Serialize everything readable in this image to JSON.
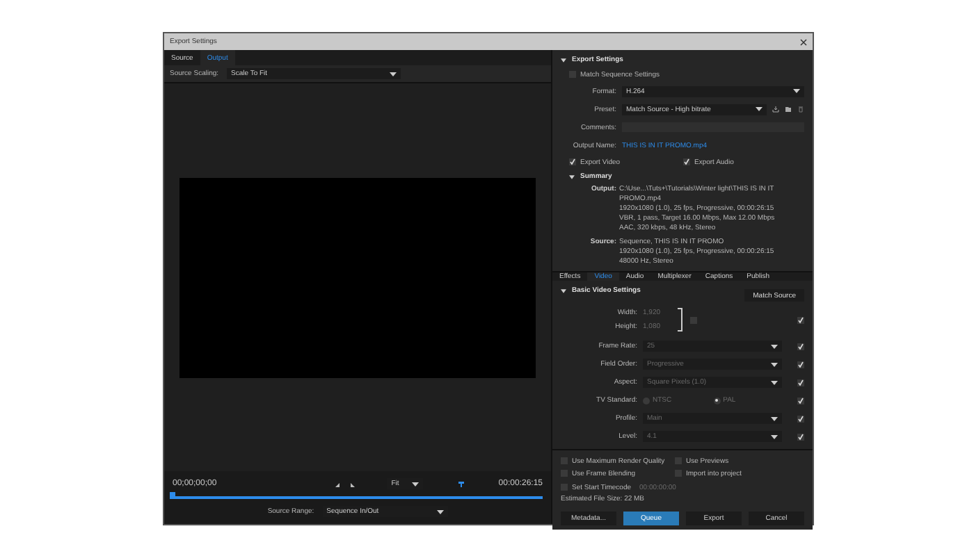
{
  "window": {
    "title": "Export Settings"
  },
  "source_tabs": [
    {
      "label": "Source",
      "selected": false
    },
    {
      "label": "Output",
      "selected": true
    }
  ],
  "source_scaling": {
    "label": "Source Scaling:",
    "value": "Scale To Fit"
  },
  "timeline": {
    "current_time": "00;00;00;00",
    "zoom": "Fit",
    "duration": "00:00:26:15",
    "level": 0,
    "source_range_label": "Source Range:",
    "source_range": "Sequence In/Out"
  },
  "export_settings": {
    "heading": "Export Settings",
    "match_sequence": {
      "label": "Match Sequence Settings",
      "checked": false
    },
    "format_label": "Format:",
    "format": "H.264",
    "preset_label": "Preset:",
    "preset": "Match Source - High bitrate",
    "comments_label": "Comments:",
    "output_name_label": "Output Name:",
    "output_name": "THIS IS IN IT PROMO.mp4",
    "exports": [
      {
        "label": "Export Video",
        "checked": true
      },
      {
        "label": "Export Audio",
        "checked": true
      }
    ],
    "summary": {
      "heading": "Summary",
      "output_label": "Output:",
      "output_lines": [
        "C:\\Use...\\Tuts+\\Tutorials\\Winter light\\THIS IS IN IT PROMO.mp4",
        "1920x1080 (1.0), 25 fps, Progressive, 00:00:26:15",
        "VBR, 1 pass, Target 16.00 Mbps, Max 12.00 Mbps",
        "AAC, 320 kbps, 48 kHz, Stereo"
      ],
      "source_label": "Source:",
      "source_lines": [
        "Sequence, THIS IS IN IT PROMO",
        "1920x1080 (1.0), 25 fps, Progressive, 00:00:26:15",
        "48000 Hz, Stereo"
      ]
    }
  },
  "settings_tabs": [
    {
      "label": "Effects",
      "selected": false
    },
    {
      "label": "Video",
      "selected": true
    },
    {
      "label": "Audio",
      "selected": false
    },
    {
      "label": "Multiplexer",
      "selected": false
    },
    {
      "label": "Captions",
      "selected": false
    },
    {
      "label": "Publish",
      "selected": false
    }
  ],
  "video_settings": {
    "heading": "Basic Video Settings",
    "match_source": "Match Source",
    "width": {
      "label": "Width:",
      "value": "1,920"
    },
    "height": {
      "label": "Height:",
      "value": "1,080"
    },
    "dimensions_checked": true,
    "rows": [
      {
        "kind": "dropdown",
        "label": "Frame Rate:",
        "value": "25",
        "checked": true
      },
      {
        "kind": "dropdown",
        "label": "Field Order:",
        "value": "Progressive",
        "checked": true
      },
      {
        "kind": "dropdown",
        "label": "Aspect:",
        "value": "Square Pixels (1.0)",
        "checked": true
      },
      {
        "kind": "radio",
        "label": "TV Standard:",
        "options": [
          {
            "label": "NTSC",
            "selected": false
          },
          {
            "label": "PAL",
            "selected": true
          }
        ],
        "checked": true
      },
      {
        "kind": "dropdown",
        "label": "Profile:",
        "value": "Main",
        "checked": true
      },
      {
        "kind": "dropdown",
        "label": "Level:",
        "value": "4.1",
        "checked": true
      }
    ]
  },
  "options": [
    {
      "label": "Use Maximum Render Quality",
      "checked": false
    },
    {
      "label": "Use Previews",
      "checked": false
    },
    {
      "label": "Use Frame Blending",
      "checked": false
    },
    {
      "label": "Import into project",
      "checked": false
    }
  ],
  "start_timecode": {
    "label": "Set Start Timecode",
    "value": "00:00:00:00",
    "checked": false
  },
  "file_size": "Estimated File Size:  22 MB",
  "buttons": [
    {
      "label": "Metadata...",
      "kind": "plain"
    },
    {
      "label": "Queue",
      "kind": "primary"
    },
    {
      "label": "Export",
      "kind": "plain"
    },
    {
      "label": "Cancel",
      "kind": "plain"
    }
  ]
}
